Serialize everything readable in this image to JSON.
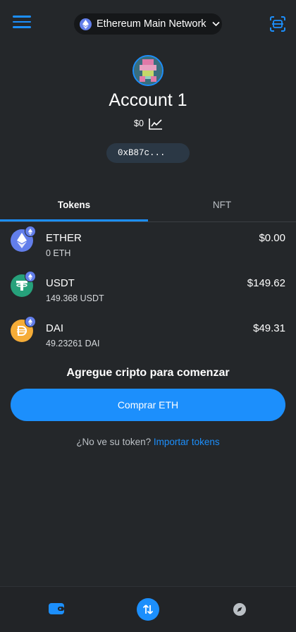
{
  "header": {
    "network_label": "Ethereum Main Network",
    "menu_icon": "hamburger-menu-icon",
    "scan_icon": "qr-scan-icon",
    "network_icon": "ethereum-icon",
    "chevron_icon": "chevron-down-icon"
  },
  "account": {
    "name": "Account 1",
    "balance": "$0",
    "address": "0xB87c...",
    "chart_icon": "line-chart-icon"
  },
  "tabs": [
    {
      "label": "Tokens",
      "active": true
    },
    {
      "label": "NFT",
      "active": false
    }
  ],
  "tokens": [
    {
      "symbol": "ETHER",
      "amount": "0 ETH",
      "fiat": "$0.00",
      "icon": "ethereum-icon",
      "color": "#627eea"
    },
    {
      "symbol": "USDT",
      "amount": "149.368 USDT",
      "fiat": "$149.62",
      "icon": "tether-icon",
      "color": "#26a17b"
    },
    {
      "symbol": "DAI",
      "amount": "49.23261 DAI",
      "fiat": "$49.31",
      "icon": "dai-icon",
      "color": "#f5ac37"
    }
  ],
  "cta": {
    "heading": "Agregue cripto para comenzar",
    "buy_label": "Comprar ETH"
  },
  "import": {
    "prompt": "¿No ve su token?",
    "link_label": "Importar tokens"
  },
  "bottom_nav": {
    "items": [
      "wallet-icon",
      "swap-icon",
      "browser-compass-icon"
    ]
  },
  "colors": {
    "accent": "#1c8ffc",
    "background": "#24272a"
  }
}
